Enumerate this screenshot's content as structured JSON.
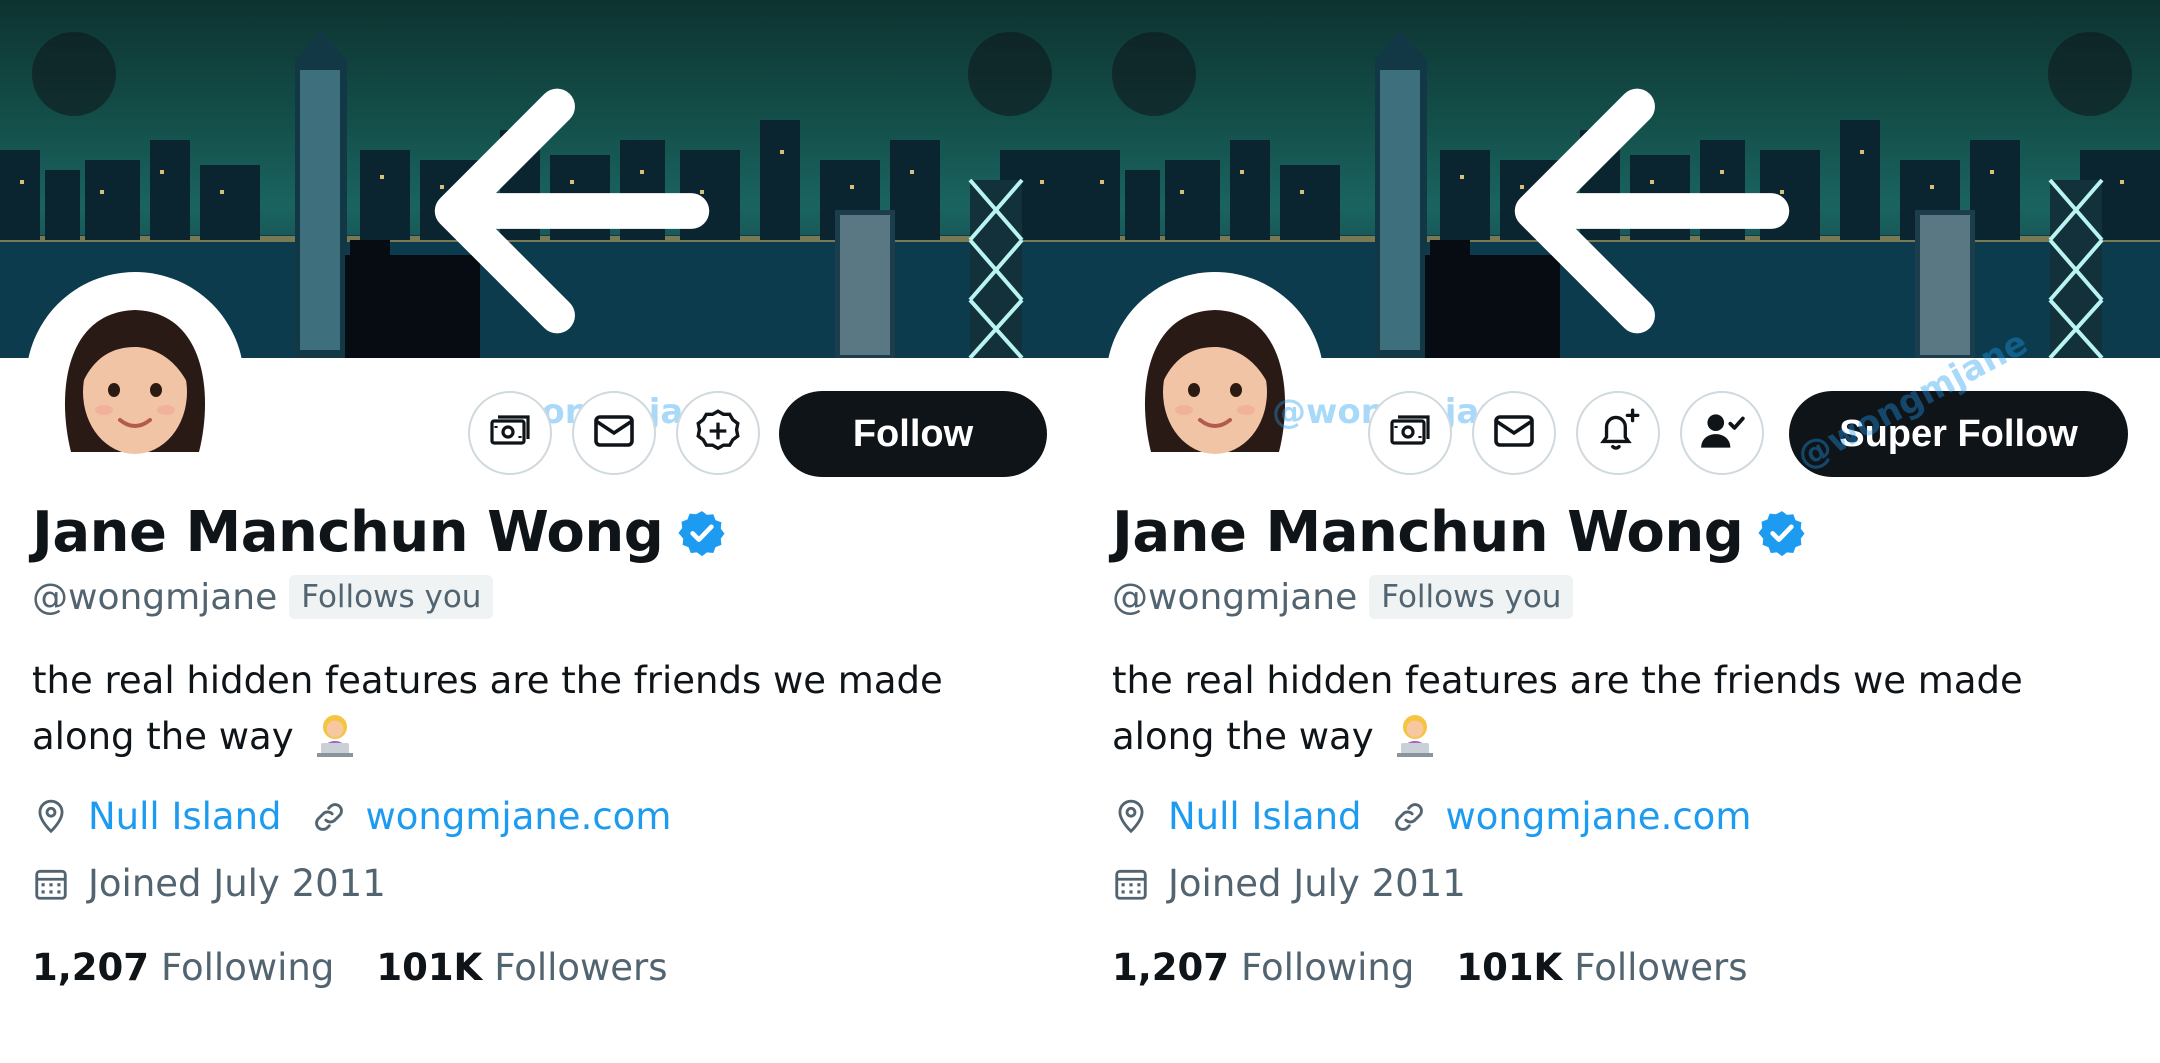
{
  "panels": [
    {
      "actions": {
        "follow_label": "Follow"
      },
      "watermark": "@wongmjane"
    },
    {
      "actions": {
        "follow_label": "Super Follow"
      },
      "watermark": "@wongmjane",
      "watermark_2": "@wongmjane"
    }
  ],
  "profile": {
    "display_name": "Jane Manchun Wong",
    "handle": "@wongmjane",
    "follows_you": "Follows you",
    "bio": "the real hidden features are the friends we made along the way",
    "location": "Null Island",
    "website": "wongmjane.com",
    "joined": "Joined July 2011",
    "following_count": "1,207",
    "following_label": "Following",
    "followers_count": "101K",
    "followers_label": "Followers"
  },
  "icons": {
    "back": "arrow-left-icon",
    "more": "more-vertical-icon",
    "tip": "money-icon",
    "message": "envelope-icon",
    "add": "circle-plus-icon",
    "notify": "bell-plus-icon",
    "subscribed": "user-check-icon",
    "verified": "verified-badge-icon",
    "location": "location-pin-icon",
    "link": "link-icon",
    "calendar": "calendar-icon"
  },
  "colors": {
    "accent": "#1d9bf0",
    "text": "#0f1419",
    "muted": "#536471",
    "button": "#0f1419"
  }
}
